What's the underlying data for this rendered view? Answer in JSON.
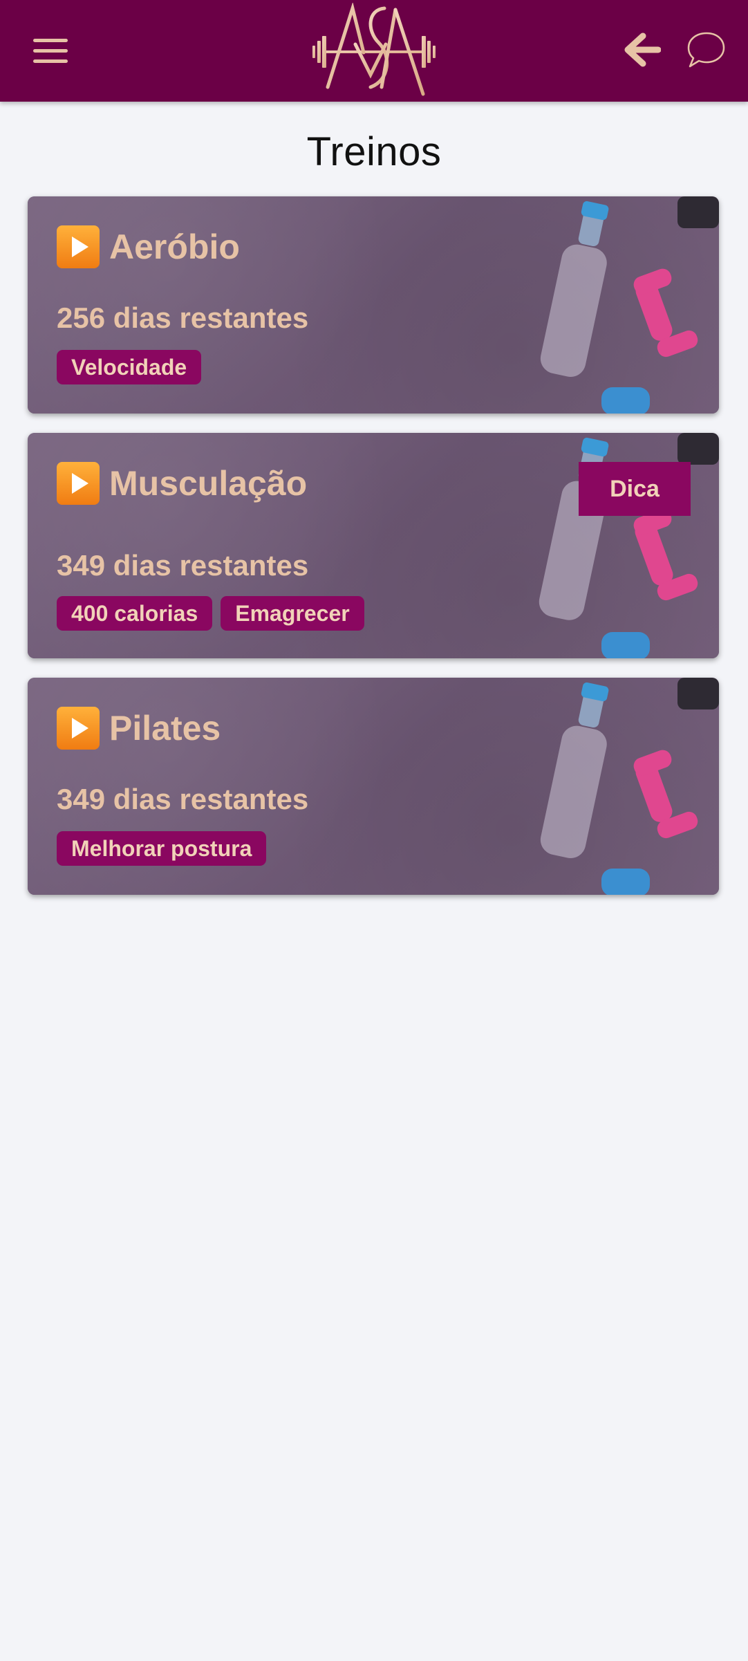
{
  "app": {
    "logo_text": "ASA",
    "colors": {
      "header": "#6b0046",
      "accent": "#e7c3a6",
      "tag": "#8a0760",
      "background": "#f3f4f8"
    }
  },
  "header": {
    "menu_icon": "hamburger-menu-icon",
    "back_icon": "arrow-left-icon",
    "chat_icon": "chat-bubble-icon"
  },
  "page": {
    "title": "Treinos"
  },
  "workouts": [
    {
      "title": "Aeróbio",
      "days_left": "256 dias restantes",
      "tags": [
        "Velocidade"
      ],
      "tip": null
    },
    {
      "title": "Musculação",
      "days_left": "349 dias restantes",
      "tags": [
        "400 calorias",
        "Emagrecer"
      ],
      "tip": "Dica"
    },
    {
      "title": "Pilates",
      "days_left": "349 dias restantes",
      "tags": [
        "Melhorar postura"
      ],
      "tip": null
    }
  ]
}
